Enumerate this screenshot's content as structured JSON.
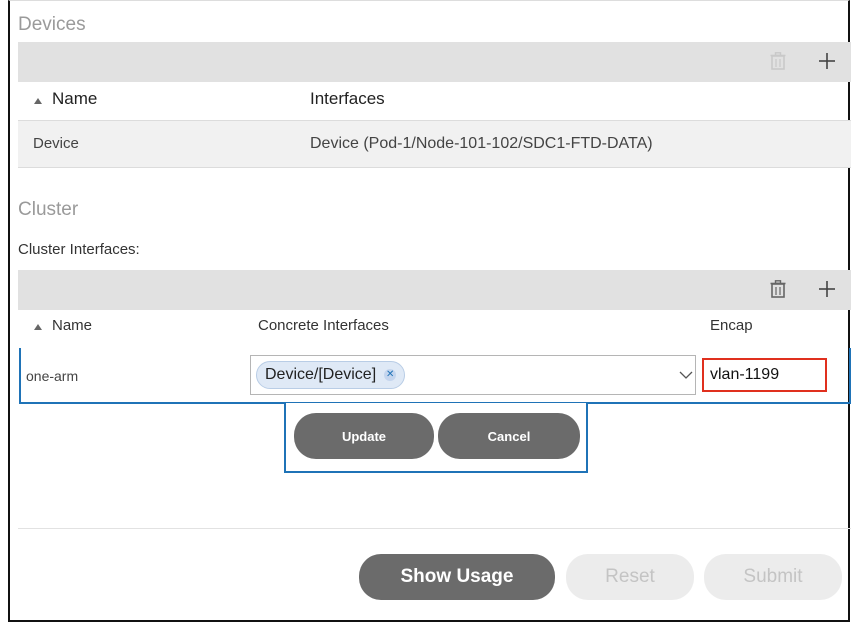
{
  "devices": {
    "title": "Devices",
    "columns": {
      "name": "Name",
      "interfaces": "Interfaces"
    },
    "rows": [
      {
        "name": "Device",
        "interfaces": "Device (Pod-1/Node-101-102/SDC1-FTD-DATA)"
      }
    ]
  },
  "cluster": {
    "title": "Cluster",
    "interfaces_label": "Cluster Interfaces:",
    "columns": {
      "name": "Name",
      "concrete": "Concrete Interfaces",
      "encap": "Encap"
    },
    "edit_row": {
      "name": "one-arm",
      "selected_interface": "Device/[Device]",
      "encap_value": "vlan-1199"
    },
    "actions": {
      "update": "Update",
      "cancel": "Cancel"
    }
  },
  "footer": {
    "show_usage": "Show Usage",
    "reset": "Reset",
    "submit": "Submit"
  },
  "icons": {
    "delete": "trash-icon",
    "add": "plus-icon",
    "sort_asc": "triangle-up-icon",
    "dropdown": "chevron-down-icon",
    "chip_remove": "x-circle-icon"
  },
  "colors": {
    "selected_border": "#1f73b7",
    "highlight": "#e0301e",
    "button_dark": "#6b6b6b",
    "toolbar": "#e1e1e1"
  }
}
